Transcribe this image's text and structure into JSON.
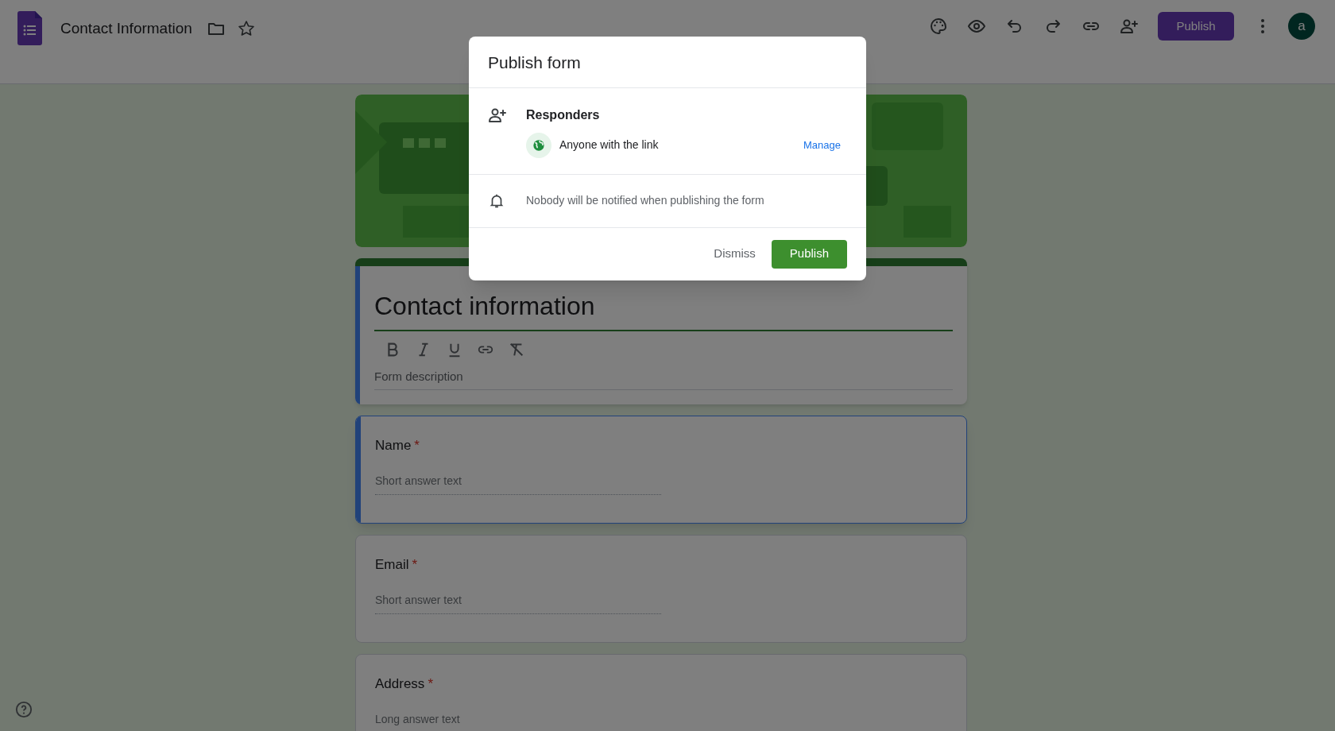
{
  "app_bar": {
    "title": "Contact Information",
    "publish_button": "Publish",
    "avatar": "a"
  },
  "form_header": {
    "title": "Contact information",
    "selected": true,
    "description_placeholder": "Form description"
  },
  "questions": [
    {
      "label": "Name",
      "required": true,
      "required_mark": "*",
      "kind": "short",
      "placeholder": "Short answer text",
      "selected": true
    },
    {
      "label": "Email",
      "required": true,
      "required_mark": "*",
      "kind": "short",
      "placeholder": "Short answer text",
      "selected": false
    },
    {
      "label": "Address",
      "required": true,
      "required_mark": "*",
      "kind": "long",
      "placeholder": "Long answer text",
      "selected": false
    }
  ],
  "dialog": {
    "title": "Publish form",
    "responders_heading": "Responders",
    "access": "Anyone with the link",
    "manage_link": "Manage",
    "notification": "Nobody will be notified when publishing the form",
    "buttons": [
      {
        "kind": "text",
        "label": "Dismiss"
      },
      {
        "kind": "primary",
        "label": "Publish"
      }
    ]
  }
}
